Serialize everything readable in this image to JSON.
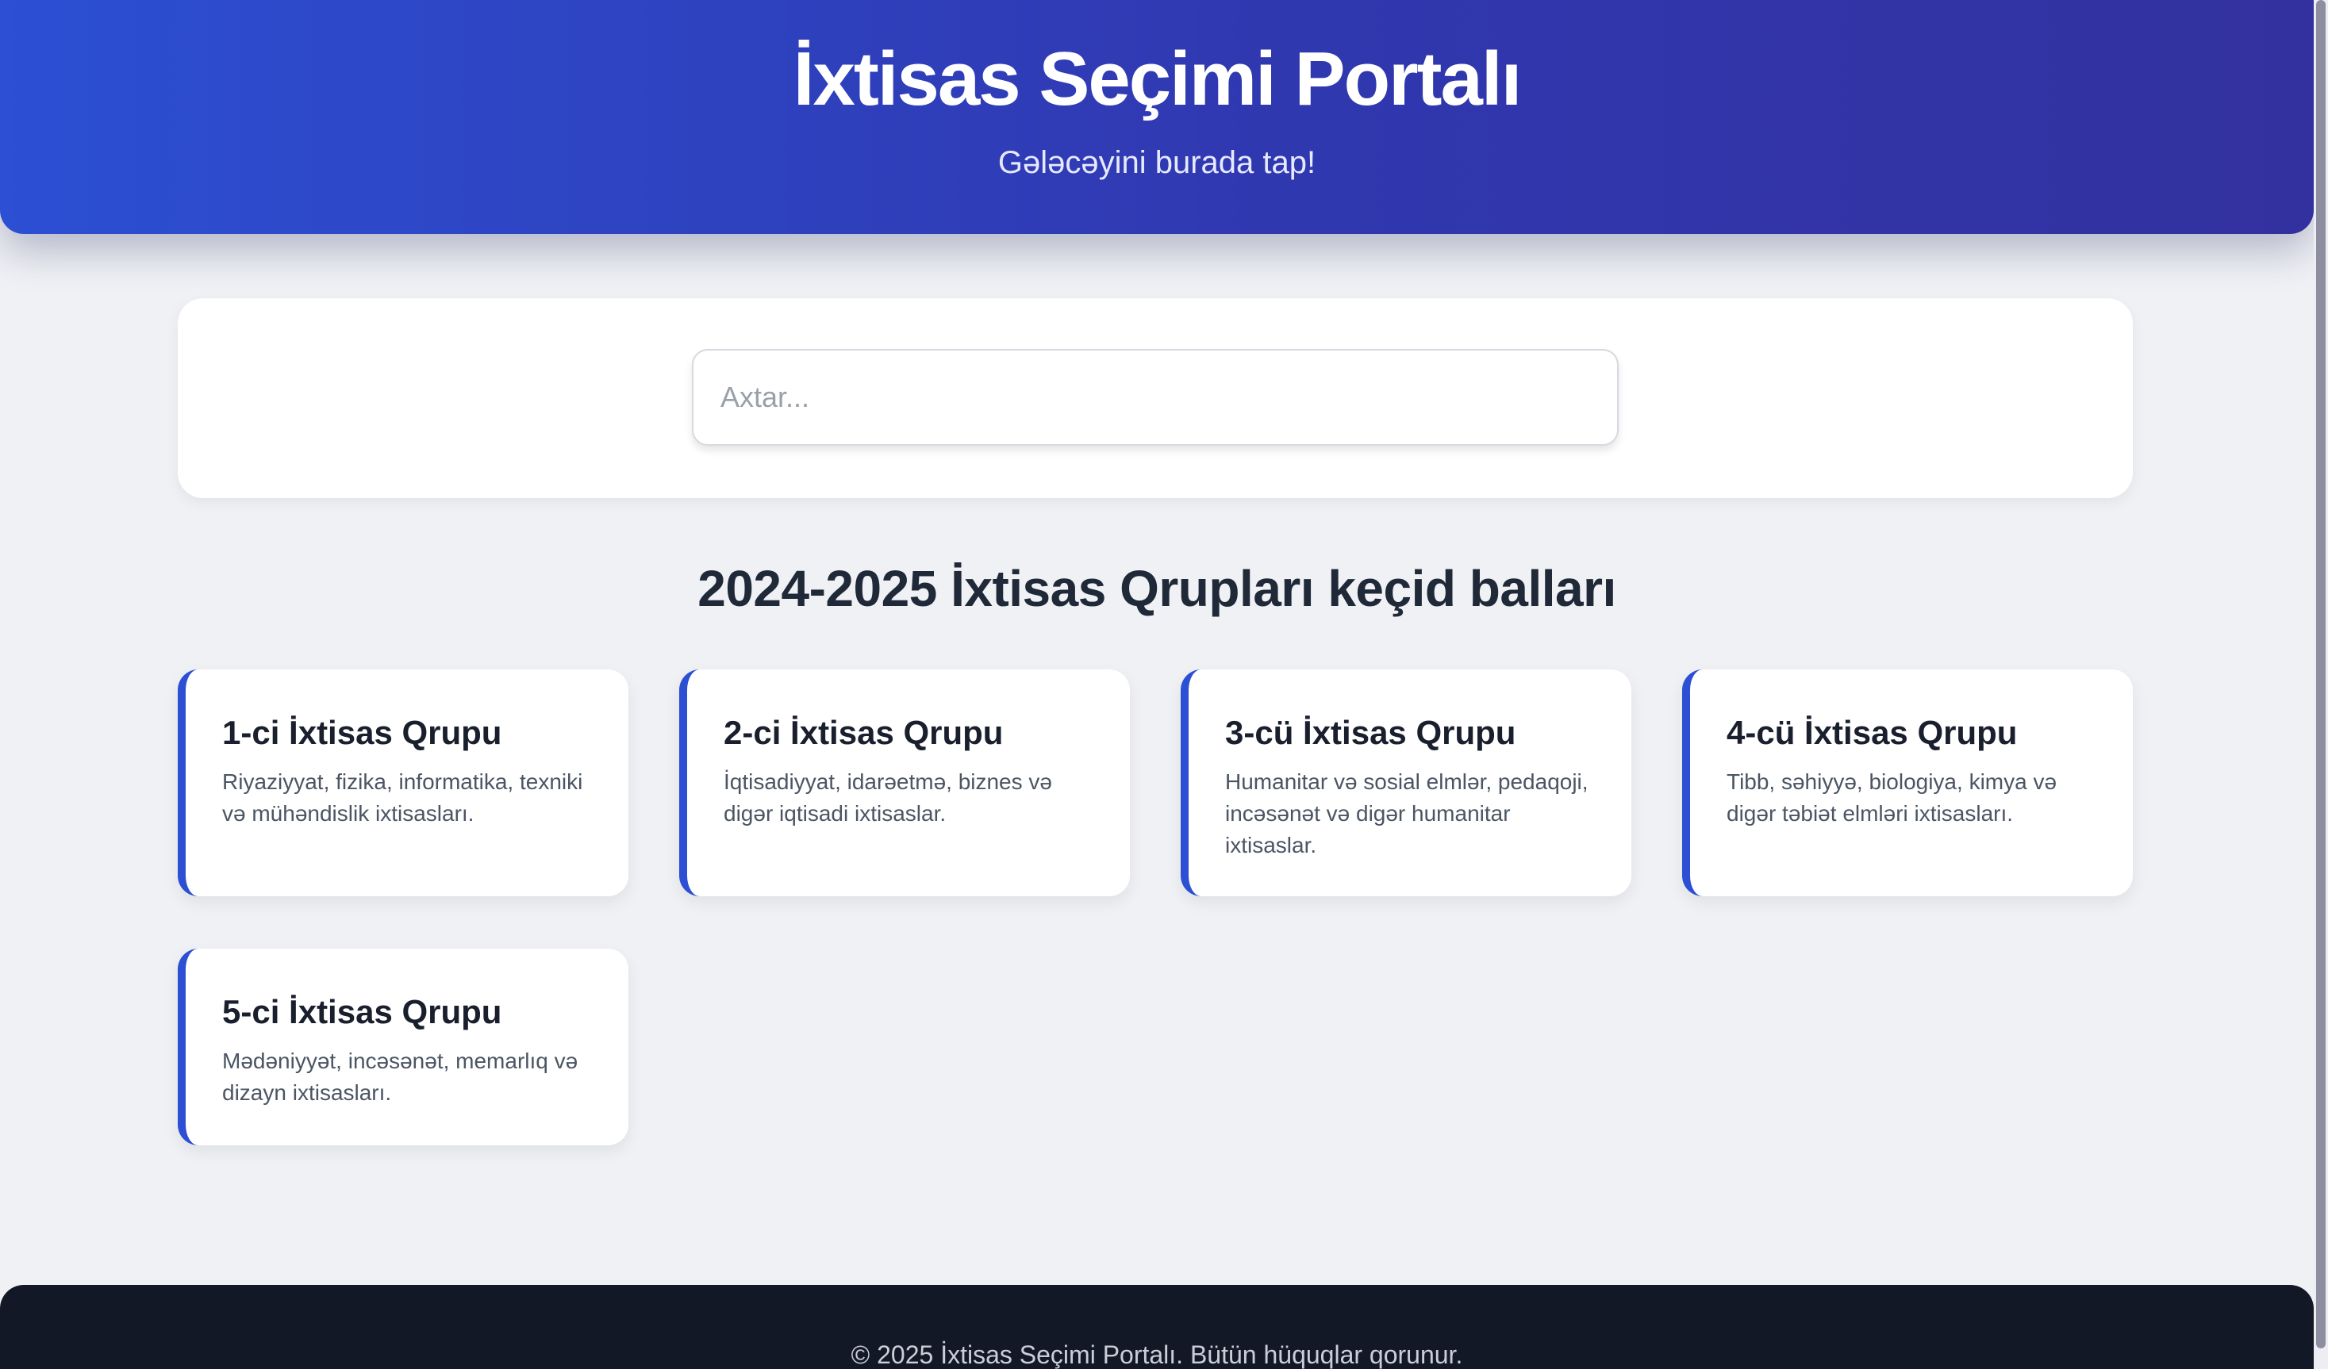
{
  "header": {
    "title": "İxtisas Seçimi Portalı",
    "subtitle": "Gələcəyini burada tap!"
  },
  "search": {
    "placeholder": "Axtar...",
    "value": ""
  },
  "section": {
    "title": "2024-2025 İxtisas Qrupları keçid balları"
  },
  "groups": [
    {
      "title": "1-ci İxtisas Qrupu",
      "description": "Riyaziyyat, fizika, informatika, texniki və mühəndislik ixtisasları."
    },
    {
      "title": "2-ci İxtisas Qrupu",
      "description": "İqtisadiyyat, idarəetmə, biznes və digər iqtisadi ixtisaslar."
    },
    {
      "title": "3-cü İxtisas Qrupu",
      "description": "Humanitar və sosial elmlər, pedaqoji, incəsənət və digər humanitar ixtisaslar."
    },
    {
      "title": "4-cü İxtisas Qrupu",
      "description": "Tibb, səhiyyə, biologiya, kimya və digər təbiət elmləri ixtisasları."
    },
    {
      "title": "5-ci İxtisas Qrupu",
      "description": "Mədəniyyət, incəsənət, memarlıq və dizayn ixtisasları."
    }
  ],
  "footer": {
    "text": "© 2025 İxtisas Seçimi Portalı. Bütün hüquqlar qorunur."
  },
  "colors": {
    "header_gradient_start": "#2c4fd3",
    "header_gradient_end": "#33319f",
    "accent": "#2c4fd3",
    "background": "#f0f1f5",
    "footer": "#121826"
  }
}
